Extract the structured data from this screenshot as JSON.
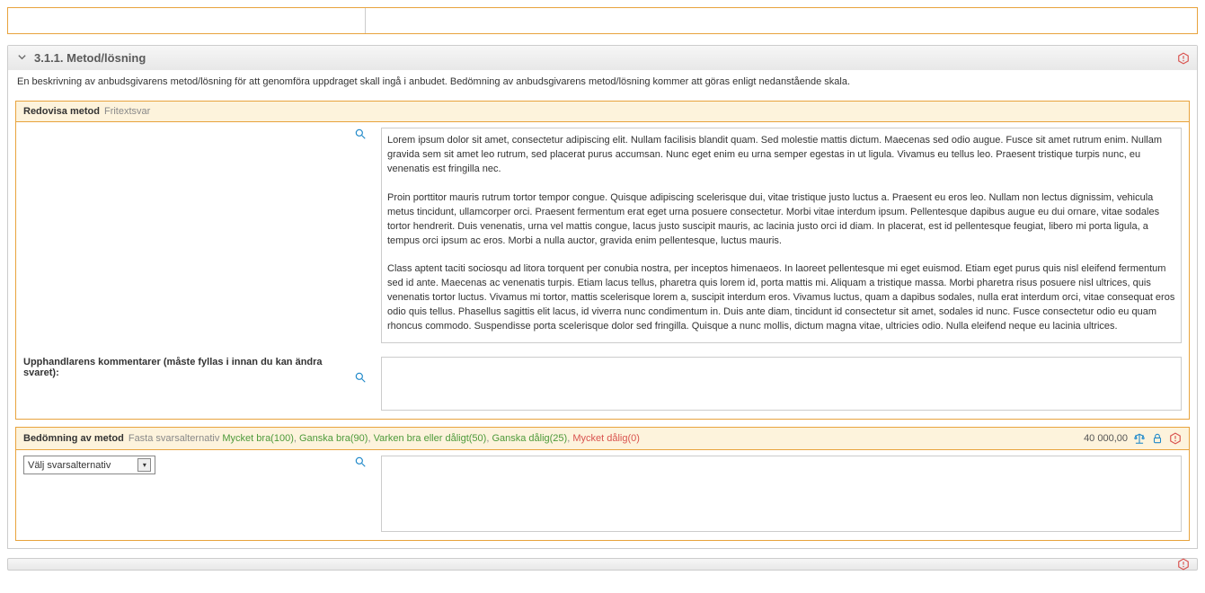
{
  "section": {
    "number": "3.1.1.",
    "title": "Metod/lösning",
    "description": "En beskrivning av anbudsgivarens metod/lösning för att genomföra uppdraget skall ingå i anbudet. Bedömning av anbudsgivarens metod/lösning kommer att göras enligt nedanstående skala."
  },
  "panel1": {
    "title": "Redovisa metod",
    "subtitle": "Fritextsvar",
    "response_text": "Lorem ipsum dolor sit amet, consectetur adipiscing elit. Nullam facilisis blandit quam. Sed molestie mattis dictum. Maecenas sed odio augue. Fusce sit amet rutrum enim. Nullam gravida sem sit amet leo rutrum, sed placerat purus accumsan. Nunc eget enim eu urna semper egestas in ut ligula. Vivamus eu tellus leo. Praesent tristique turpis nunc, eu venenatis est fringilla nec.\n\nProin porttitor mauris rutrum tortor tempor congue. Quisque adipiscing scelerisque dui, vitae tristique justo luctus a. Praesent eu eros leo. Nullam non lectus dignissim, vehicula metus tincidunt, ullamcorper orci. Praesent fermentum erat eget urna posuere consectetur. Morbi vitae interdum ipsum. Pellentesque dapibus augue eu dui ornare, vitae sodales tortor hendrerit. Duis venenatis, urna vel mattis congue, lacus justo suscipit mauris, ac lacinia justo orci id diam. In placerat, est id pellentesque feugiat, libero mi porta ligula, a tempus orci ipsum ac eros. Morbi a nulla auctor, gravida enim pellentesque, luctus mauris.\n\nClass aptent taciti sociosqu ad litora torquent per conubia nostra, per inceptos himenaeos. In laoreet pellentesque mi eget euismod. Etiam eget purus quis nisl eleifend fermentum sed id ante. Maecenas ac venenatis turpis. Etiam lacus tellus, pharetra quis lorem id, porta mattis mi. Aliquam a tristique massa. Morbi pharetra risus posuere nisl ultrices, quis venenatis tortor luctus. Vivamus mi tortor, mattis scelerisque lorem a, suscipit interdum eros. Vivamus luctus, quam a dapibus sodales, nulla erat interdum orci, vitae consequat eros odio quis tellus. Phasellus sagittis elit lacus, id viverra nunc condimentum in. Duis ante diam, tincidunt id consectetur sit amet, sodales id nunc. Fusce consectetur odio eu quam rhoncus commodo. Suspendisse porta scelerisque dolor sed fringilla. Quisque a nunc mollis, dictum magna vitae, ultricies odio. Nulla eleifend neque eu lacinia ultrices.",
    "comment_label": "Upphandlarens kommentarer (måste fyllas i innan du kan ändra svaret):",
    "comment_value": ""
  },
  "panel2": {
    "title": "Bedömning av metod",
    "subtitle": "Fasta svarsalternativ",
    "options": {
      "o1": "Mycket bra(100)",
      "o2": "Ganska bra(90)",
      "o3": "Varken bra eller dåligt(50)",
      "o4": "Ganska dålig(25)",
      "o5": "Mycket dålig(0)",
      "sep": ", "
    },
    "value_number": "40 000,00",
    "select_placeholder": "Välj svarsalternativ",
    "response_value": ""
  },
  "colors": {
    "accent_border": "#e8a33d",
    "warn": "#d9534f",
    "good": "#4d9a3a",
    "link": "#1e88c9"
  }
}
